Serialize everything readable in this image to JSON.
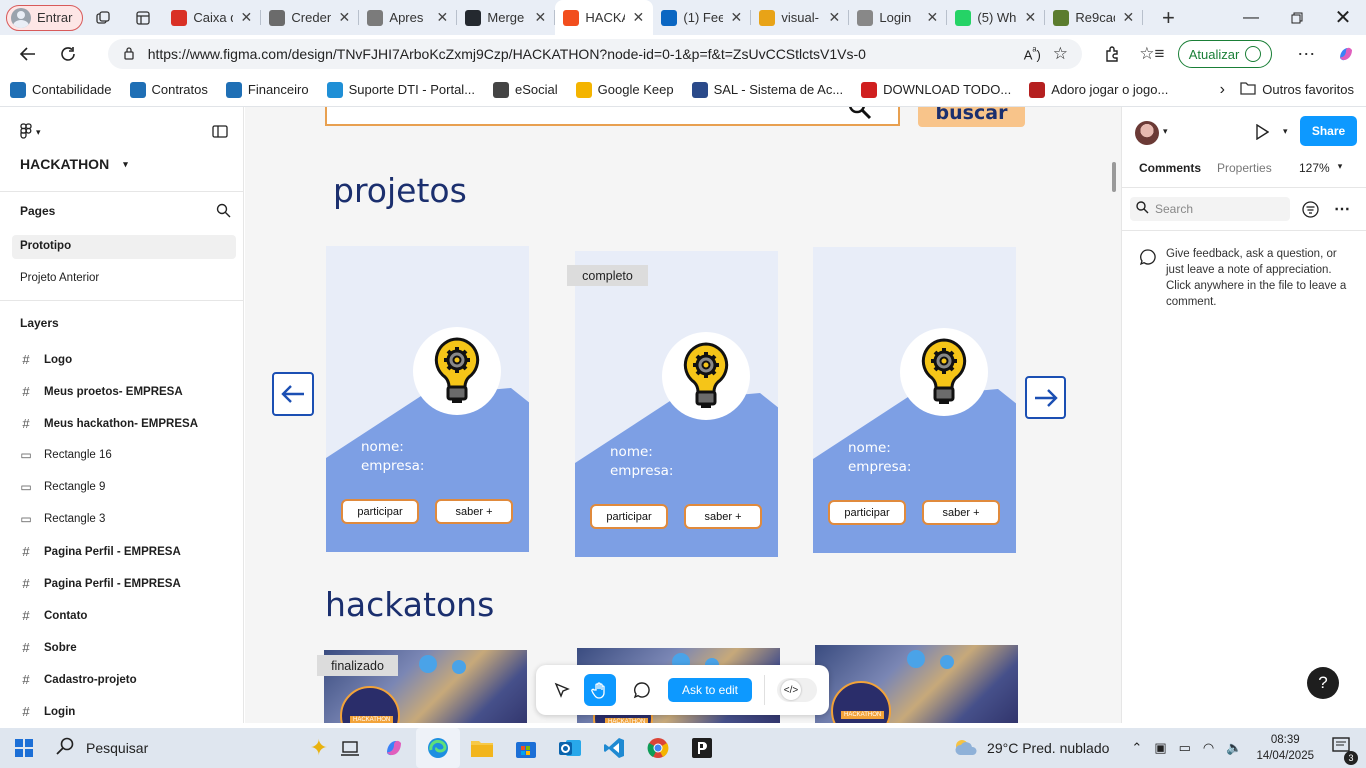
{
  "browser": {
    "profile_label": "Entrar",
    "tabs": [
      {
        "label": "Caixa d",
        "icon": "gmail-icon",
        "color": "#d93025"
      },
      {
        "label": "Creden",
        "icon": "ai-icon",
        "color": "#6b6b6b"
      },
      {
        "label": "Apres",
        "icon": "drawing-icon",
        "color": "#7b7b7b"
      },
      {
        "label": "Merge",
        "icon": "github-icon",
        "color": "#24292f"
      },
      {
        "label": "HACKA",
        "icon": "figma-icon",
        "color": "#f24e1e",
        "active": true
      },
      {
        "label": "(1) Fee",
        "icon": "linkedin-icon",
        "color": "#0a66c2"
      },
      {
        "label": "visual-",
        "icon": "heart-icon",
        "color": "#e8a317"
      },
      {
        "label": "Login",
        "icon": "gear-icon",
        "color": "#888888"
      },
      {
        "label": "(5) Wh",
        "icon": "whatsapp-icon",
        "color": "#25d366"
      },
      {
        "label": "Re9cad",
        "icon": "tree-icon",
        "color": "#5b7c2e"
      }
    ],
    "url": "https://www.figma.com/design/TNvFJHI7ArboKcZxmj9Czp/HACKATHON?node-id=0-1&p=f&t=ZsUvCCStlctsV1Vs-0",
    "update_label": "Atualizar",
    "bookmarks": [
      {
        "label": "Contabilidade",
        "color": "#1f6fb5"
      },
      {
        "label": "Contratos",
        "color": "#1f6fb5"
      },
      {
        "label": "Financeiro",
        "color": "#1f6fb5"
      },
      {
        "label": "Suporte DTI - Portal...",
        "color": "#1f8fd6"
      },
      {
        "label": "eSocial",
        "color": "#444444"
      },
      {
        "label": "Google Keep",
        "color": "#f4b400"
      },
      {
        "label": "SAL - Sistema de Ac...",
        "color": "#2b4a8a"
      },
      {
        "label": "DOWNLOAD TODO...",
        "color": "#d01f1f"
      },
      {
        "label": "Adoro jogar o jogo...",
        "color": "#b52020"
      }
    ],
    "other_favorites": "Outros favoritos"
  },
  "figma": {
    "file_name": "HACKATHON",
    "pages_title": "Pages",
    "pages": [
      "Prototipo",
      "Projeto Anterior"
    ],
    "layers_title": "Layers",
    "layers": [
      {
        "name": "Logo",
        "kind": "frame"
      },
      {
        "name": "Meus proetos- EMPRESA",
        "kind": "frame"
      },
      {
        "name": "Meus hackathon- EMPRESA",
        "kind": "frame"
      },
      {
        "name": "Rectangle 16",
        "kind": "rect"
      },
      {
        "name": "Rectangle 9",
        "kind": "rect"
      },
      {
        "name": "Rectangle 3",
        "kind": "rect"
      },
      {
        "name": "Pagina  Perfil - EMPRESA",
        "kind": "frame"
      },
      {
        "name": "Pagina  Perfil - EMPRESA",
        "kind": "frame"
      },
      {
        "name": "Contato",
        "kind": "frame"
      },
      {
        "name": "Sobre",
        "kind": "frame"
      },
      {
        "name": "Cadastro-projeto",
        "kind": "frame"
      },
      {
        "name": "Login",
        "kind": "frame"
      }
    ],
    "right": {
      "share_label": "Share",
      "tab_comments": "Comments",
      "tab_properties": "Properties",
      "zoom": "127%",
      "search_placeholder": "Search",
      "hint": "Give feedback, ask a question, or just leave a note of appreciation. Click anywhere in the file to leave a comment."
    },
    "toolbar": {
      "ask_label": "Ask to edit"
    },
    "help_label": "?"
  },
  "design": {
    "search_button": "buscar",
    "projects_title": "projetos",
    "complete_badge": "completo",
    "cards": [
      {
        "name_label": "nome:",
        "company_label": "empresa:",
        "join_label": "participar",
        "more_label": "saber +"
      },
      {
        "name_label": "nome:",
        "company_label": "empresa:",
        "join_label": "participar",
        "more_label": "saber +"
      },
      {
        "name_label": "nome:",
        "company_label": "empresa:",
        "join_label": "participar",
        "more_label": "saber +"
      }
    ],
    "hackathons_title": "hackatons",
    "finished_badge": "finalizado",
    "hackathon_card_tag": "HACKATHON"
  },
  "taskbar": {
    "search_placeholder": "Pesquisar",
    "weather": "29°C  Pred. nublado",
    "time": "08:39",
    "date": "14/04/2025",
    "notifications": "3"
  },
  "colors": {
    "card_blue": "#7d9fe4",
    "card_bg": "#e8edf8",
    "orange": "#e08a3c",
    "title_navy": "#1b2f6e",
    "figma_blue": "#0d99ff"
  }
}
